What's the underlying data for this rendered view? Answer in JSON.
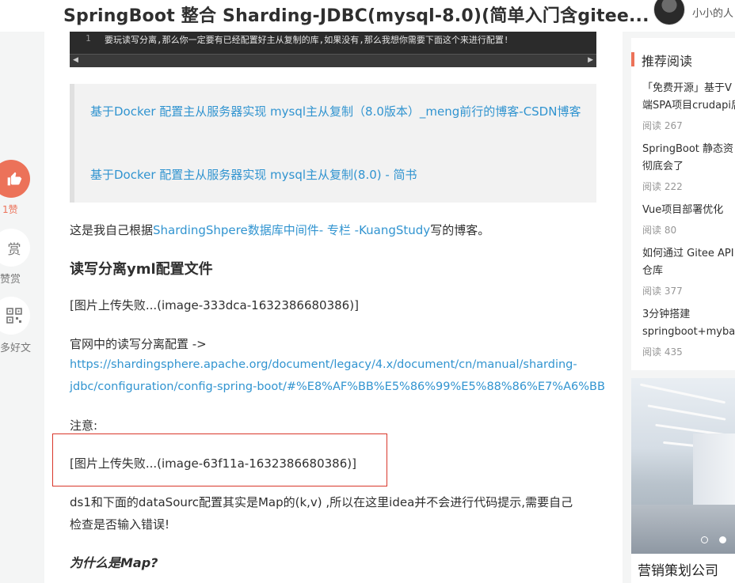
{
  "header": {
    "title": "SpringBoot 整合 Sharding-JDBC(mysql-8.0)(简单入门含gitee...",
    "username": "小小的人"
  },
  "toolbar": {
    "like_count": "1赞",
    "reward_glyph": "赏",
    "reward_label": "赞赏",
    "more_label": "多好文"
  },
  "code_block": {
    "line_number": "1",
    "text": "要玩读写分离,那么你一定要有已经配置好主从复制的库,如果没有,那么我想你需要下面这个来进行配置!"
  },
  "quote": {
    "link1": "基于Docker 配置主从服务器实现 mysql主从复制（8.0版本）_meng前行的博客-CSDN博客",
    "link2": "基于Docker 配置主从服务器实现 mysql主从复制(8.0) - 简书"
  },
  "article": {
    "intro_prefix": "这是我自己根据",
    "intro_link": "ShardingShpere数据库中间件- 专栏 -KuangStudy",
    "intro_suffix": "写的博客。",
    "heading": "读写分离yml配置文件",
    "image_failed_1": "[图片上传失败...(image-333dca-1632386680386)]",
    "official_label": "官网中的读写分离配置 ->",
    "url_line1": "https://shardingsphere.apache.org/document/legacy/4.x/document/cn/manual/sharding-",
    "url_line2": "jdbc/configuration/config-spring-boot/#%E8%AF%BB%E5%86%99%E5%88%86%E7%A6%BB",
    "note": "注意:",
    "image_failed_2": "[图片上传失败...(image-63f11a-1632386680386)]",
    "ds_line1": "ds1和下面的dataSourc配置其实是Map的(k,v) ,所以在这里idea并不会进行代码提示,需要自己",
    "ds_line2": "检查是否输入错误!",
    "why_heading": "为什么是Map?"
  },
  "recommend": {
    "heading": "推荐阅读",
    "items": [
      {
        "line1": "「免费开源」基于V",
        "line2": "端SPA项目crudapi后",
        "reads": "阅读 267"
      },
      {
        "line1": "SpringBoot 静态资",
        "line2": "彻底会了",
        "reads": "阅读 222"
      },
      {
        "line1": "Vue项目部署优化",
        "line2": "",
        "reads": "阅读 80"
      },
      {
        "line1": "如何通过 Gitee API",
        "line2": "仓库",
        "reads": "阅读 377"
      },
      {
        "line1": "3分钟搭建",
        "line2": "springboot+mybat",
        "reads": "阅读 435"
      }
    ]
  },
  "ad": {
    "caption": "营销策划公司"
  },
  "colors": {
    "accent": "#ec7259",
    "link": "#3194d0",
    "highlight_box": "#d9372b"
  }
}
